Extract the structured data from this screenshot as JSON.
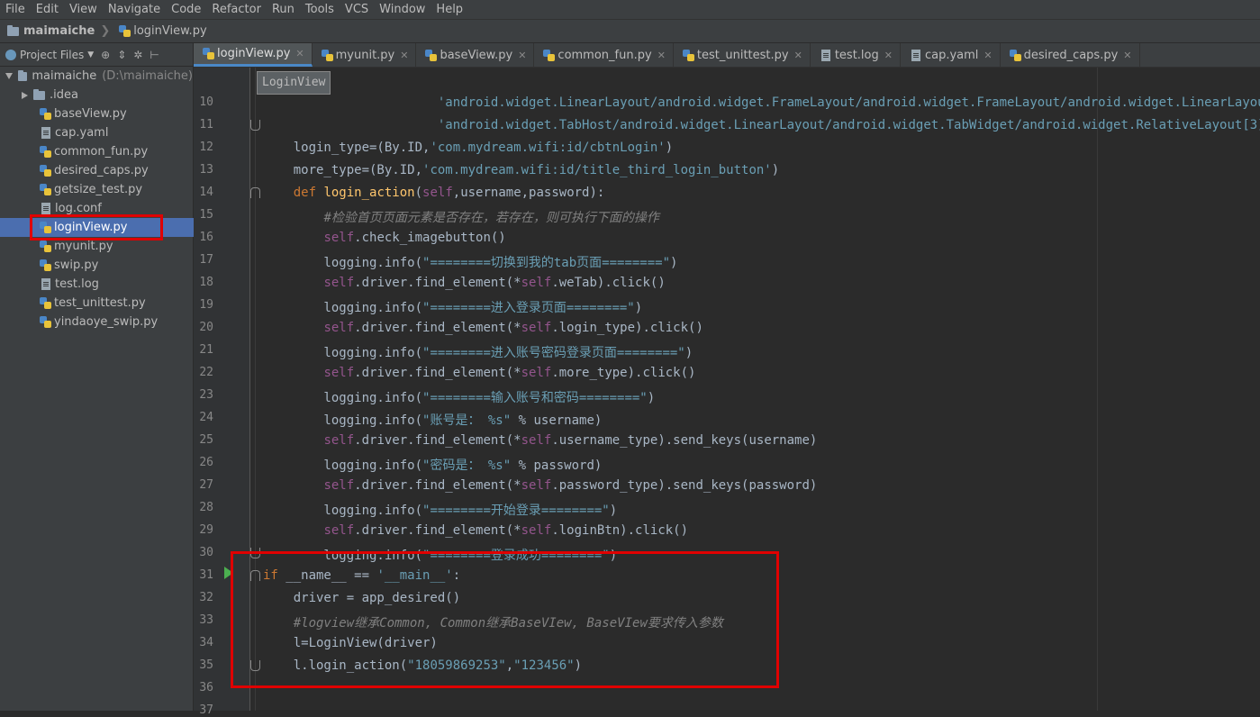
{
  "menu": [
    "File",
    "Edit",
    "View",
    "Navigate",
    "Code",
    "Refactor",
    "Run",
    "Tools",
    "VCS",
    "Window",
    "Help"
  ],
  "breadcrumb": {
    "project": "maimaiche",
    "file": "loginView.py"
  },
  "sidebar": {
    "dropdown_label": "Project Files",
    "root": {
      "name": "maimaiche",
      "path": "(D:\\maimaiche)"
    },
    "items": [
      {
        "name": ".idea",
        "type": "folder"
      },
      {
        "name": "baseView.py",
        "type": "py"
      },
      {
        "name": "cap.yaml",
        "type": "file"
      },
      {
        "name": "common_fun.py",
        "type": "py"
      },
      {
        "name": "desired_caps.py",
        "type": "py"
      },
      {
        "name": "getsize_test.py",
        "type": "py"
      },
      {
        "name": "log.conf",
        "type": "file"
      },
      {
        "name": "loginView.py",
        "type": "py",
        "selected": true
      },
      {
        "name": "myunit.py",
        "type": "py"
      },
      {
        "name": "swip.py",
        "type": "py"
      },
      {
        "name": "test.log",
        "type": "file"
      },
      {
        "name": "test_unittest.py",
        "type": "py"
      },
      {
        "name": "yindaoye_swip.py",
        "type": "py"
      }
    ]
  },
  "tabs": [
    {
      "label": "loginView.py",
      "type": "py",
      "active": true
    },
    {
      "label": "myunit.py",
      "type": "py"
    },
    {
      "label": "baseView.py",
      "type": "py"
    },
    {
      "label": "common_fun.py",
      "type": "py"
    },
    {
      "label": "test_unittest.py",
      "type": "py"
    },
    {
      "label": "test.log",
      "type": "file"
    },
    {
      "label": "cap.yaml",
      "type": "file"
    },
    {
      "label": "desired_caps.py",
      "type": "py"
    }
  ],
  "tooltip": "LoginView",
  "line_numbers": [
    "10",
    "11",
    "12",
    "13",
    "14",
    "15",
    "16",
    "17",
    "18",
    "19",
    "20",
    "21",
    "22",
    "23",
    "24",
    "25",
    "26",
    "27",
    "28",
    "29",
    "30",
    "31",
    "32",
    "33",
    "34",
    "35",
    "36",
    "37"
  ],
  "colors": {
    "accent": "#4a88c7",
    "highlight_box": "#e00000",
    "selection": "#4b6eaf",
    "run_icon": "#4caf50"
  }
}
